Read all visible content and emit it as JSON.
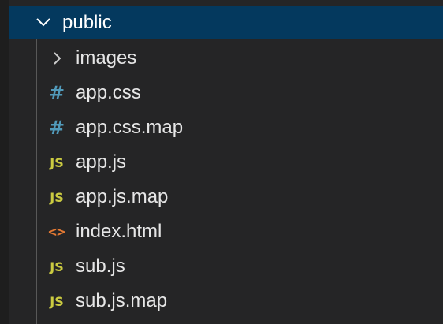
{
  "explorer": {
    "root_folder": {
      "label": "public",
      "expanded": true,
      "chevron": "chevron-down-icon"
    },
    "items": [
      {
        "label": "images",
        "type": "folder",
        "icon": "chevron-right-icon"
      },
      {
        "label": "app.css",
        "type": "css",
        "icon_glyph": "#"
      },
      {
        "label": "app.css.map",
        "type": "css",
        "icon_glyph": "#"
      },
      {
        "label": "app.js",
        "type": "js",
        "icon_glyph": "JS"
      },
      {
        "label": "app.js.map",
        "type": "js",
        "icon_glyph": "JS"
      },
      {
        "label": "index.html",
        "type": "html",
        "icon_glyph": "<>"
      },
      {
        "label": "sub.js",
        "type": "js",
        "icon_glyph": "JS"
      },
      {
        "label": "sub.js.map",
        "type": "js",
        "icon_glyph": "JS"
      }
    ],
    "colors": {
      "background": "#252526",
      "selected_row": "#04395e",
      "css_icon": "#519aba",
      "js_icon": "#cbcb41",
      "html_icon": "#e37933",
      "text": "#e6e6e6"
    }
  }
}
